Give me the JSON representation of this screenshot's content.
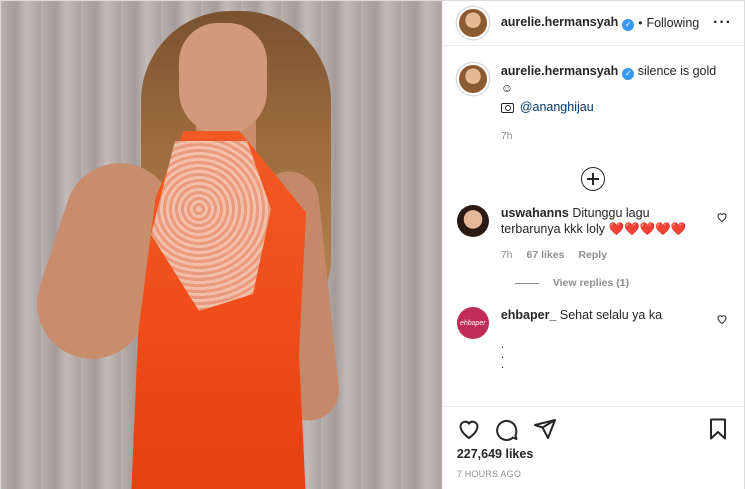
{
  "post": {
    "username": "aurelie.hermansyah",
    "follow_status": "Following",
    "more_icon": "more-dots-icon",
    "caption_text": "silence is gold",
    "caption_emoji": "☺",
    "camera_credit": "@ananghijau",
    "caption_time": "7h",
    "likes": "227,649 likes",
    "posted": "7 HOURS AGO"
  },
  "comments": [
    {
      "username": "uswahanns",
      "text": "Ditunggu lagu terbarunya kkk loly",
      "hearts": "❤️❤️❤️❤️❤️",
      "time": "7h",
      "likes": "67 likes",
      "reply": "Reply",
      "view_replies": "View replies (1)"
    },
    {
      "username": "ehbaper_",
      "text": "Sehat selalu ya ka",
      "avatar_text": "ehbaper"
    }
  ],
  "colors": {
    "verified": "#3897f0",
    "text": "#262626",
    "muted": "#8e8e8e",
    "link": "#00376b",
    "heart": "#e0132b",
    "dress": "#f15a24"
  }
}
